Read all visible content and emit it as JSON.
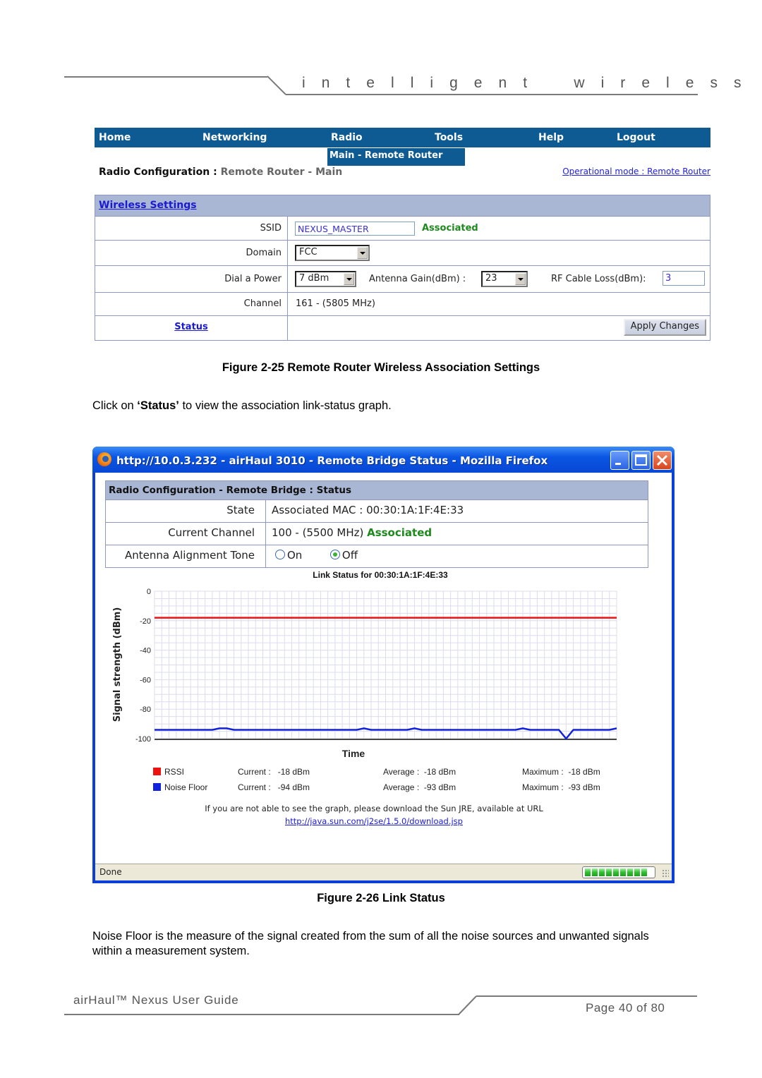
{
  "header": {
    "tagline": "i n t e l l i g e n t    w i r e l e s s    p l a t f o r m"
  },
  "router_ui": {
    "nav": [
      {
        "label": "Home"
      },
      {
        "label": "Networking"
      },
      {
        "label": "Radio"
      },
      {
        "label": "Tools"
      },
      {
        "label": "Help"
      },
      {
        "label": "Logout"
      }
    ],
    "submenu_item": "Main - Remote Router",
    "page_title": "Radio Configuration",
    "page_title_sep": " : ",
    "page_subtitle": "Remote Router - Main",
    "operational_mode_link": "Operational mode : Remote Router",
    "wireless_settings": {
      "heading": "Wireless Settings",
      "ssid_label": "SSID",
      "ssid_value": "NEXUS_MASTER",
      "ssid_status": "Associated",
      "domain_label": "Domain",
      "domain_value": "FCC",
      "power_label": "Dial a Power",
      "power_value": "7 dBm",
      "antenna_gain_label": "Antenna Gain(dBm) :",
      "antenna_gain_value": "23",
      "cable_loss_label": "RF Cable Loss(dBm):",
      "cable_loss_value": "3",
      "channel_label": "Channel",
      "channel_value": "161 - (5805 MHz)",
      "status_link": "Status",
      "apply_button": "Apply Changes"
    }
  },
  "figure1_caption": "Figure 2-25 Remote Router Wireless Association Settings",
  "instruction": {
    "before": "Click on ",
    "bold": "‘Status’",
    "after": " to view the association link-status graph."
  },
  "browser": {
    "title": "http://10.0.3.232 - airHaul 3010 - Remote Bridge Status - Mozilla Firefox",
    "status_text": "Done",
    "progress_segments": 9,
    "status_table": {
      "heading": "Radio Configuration - Remote Bridge : Status",
      "rows": [
        {
          "label": "State",
          "value": "Associated MAC : 00:30:1A:1F:4E:33"
        },
        {
          "label": "Current Channel",
          "value": "100 - (5500 MHz) ",
          "status": "Associated"
        },
        {
          "label": "Antenna Alignment Tone",
          "radio_on": "On",
          "radio_off": "Off",
          "selected": "Off"
        }
      ]
    },
    "legend": [
      {
        "name": "RSSI",
        "color": "#ee1111",
        "current_label": "Current :",
        "current": "-18 dBm",
        "average_label": "Average :",
        "average": "-18 dBm",
        "maximum_label": "Maximum :",
        "maximum": "-18 dBm"
      },
      {
        "name": "Noise Floor",
        "color": "#1122dd",
        "current_label": "Current :",
        "current": "-94 dBm",
        "average_label": "Average :",
        "average": "-93 dBm",
        "maximum_label": "Maximum :",
        "maximum": "-93 dBm"
      }
    ],
    "jre_note": "If you are not able to see the graph, please download the Sun JRE, available at URL",
    "jre_url": "http://java.sun.com/j2se/1.5.0/download.jsp"
  },
  "chart_data": {
    "type": "line",
    "title": "Link Status for 00:30:1A:1F:4E:33",
    "xlabel": "Time",
    "ylabel": "Signal strength (dBm)",
    "ylim": [
      -100,
      0
    ],
    "yticks": [
      0,
      -20,
      -40,
      -60,
      -80,
      -100
    ],
    "grid": true,
    "x": [
      0,
      1,
      2,
      3,
      4,
      5,
      6,
      7,
      8,
      9,
      10,
      11,
      12,
      13,
      14,
      15,
      16,
      17,
      18,
      19,
      20,
      21,
      22,
      23,
      24,
      25,
      26,
      27,
      28,
      29,
      30,
      31,
      32,
      33,
      34,
      35,
      36,
      37,
      38,
      39,
      40,
      41,
      42,
      43,
      44,
      45,
      46,
      47,
      48,
      49,
      50,
      51,
      52,
      53,
      54,
      55,
      56,
      57,
      58,
      59,
      60,
      61,
      62,
      63,
      64
    ],
    "series": [
      {
        "name": "RSSI",
        "color": "#ee1111",
        "values": [
          -18,
          -18,
          -18,
          -18,
          -18,
          -18,
          -18,
          -18,
          -18,
          -18,
          -18,
          -18,
          -18,
          -18,
          -18,
          -18,
          -18,
          -18,
          -18,
          -18,
          -18,
          -18,
          -18,
          -18,
          -18,
          -18,
          -18,
          -18,
          -18,
          -18,
          -18,
          -18,
          -18,
          -18,
          -18,
          -18,
          -18,
          -18,
          -18,
          -18,
          -18,
          -18,
          -18,
          -18,
          -18,
          -18,
          -18,
          -18,
          -18,
          -18,
          -18,
          -18,
          -18,
          -18,
          -18,
          -18,
          -18,
          -18,
          -18,
          -18,
          -18,
          -18,
          -18,
          -18,
          -18
        ]
      },
      {
        "name": "Noise Floor",
        "color": "#1122dd",
        "values": [
          -94,
          -94,
          -94,
          -94,
          -94,
          -94,
          -94,
          -94,
          -94,
          -93,
          -93,
          -94,
          -94,
          -94,
          -94,
          -94,
          -94,
          -94,
          -94,
          -94,
          -94,
          -94,
          -94,
          -94,
          -94,
          -94,
          -94,
          -94,
          -94,
          -93,
          -94,
          -94,
          -94,
          -94,
          -94,
          -94,
          -93,
          -94,
          -94,
          -94,
          -94,
          -94,
          -94,
          -94,
          -94,
          -94,
          -94,
          -94,
          -94,
          -94,
          -94,
          -93,
          -94,
          -94,
          -94,
          -94,
          -94,
          -100,
          -94,
          -94,
          -94,
          -94,
          -94,
          -94,
          -93
        ]
      }
    ]
  },
  "figure2_caption": "Figure 2-26 Link Status",
  "noise_paragraph": "Noise Floor is the measure of the signal created from the sum of all the noise sources and unwanted signals within a measurement system.",
  "footer": {
    "guide_title": "airHaul™ Nexus User Guide",
    "page": "Page 40 of 80"
  }
}
